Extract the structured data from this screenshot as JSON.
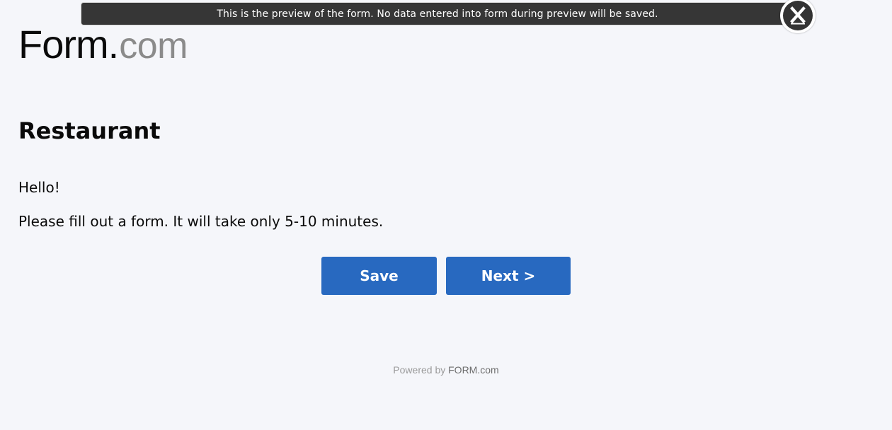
{
  "preview_bar": {
    "message": "This is the preview of the form. No data entered into form during preview will be saved.",
    "close_label": "X"
  },
  "logo": {
    "brand": "Form",
    "dot": ".",
    "tld": "com"
  },
  "form": {
    "title": "Restaurant",
    "greeting": "Hello!",
    "intro": "Please fill out a form. It will take only 5-10 minutes."
  },
  "actions": {
    "save_label": "Save",
    "next_label": "Next >"
  },
  "footer": {
    "powered_prefix": "Powered by ",
    "powered_brand": "FORM.com"
  },
  "colors": {
    "page_background": "#f5f6fa",
    "preview_bar": "#363636",
    "button_blue": "#2869c0"
  },
  "icons": {
    "close": "close-icon"
  }
}
